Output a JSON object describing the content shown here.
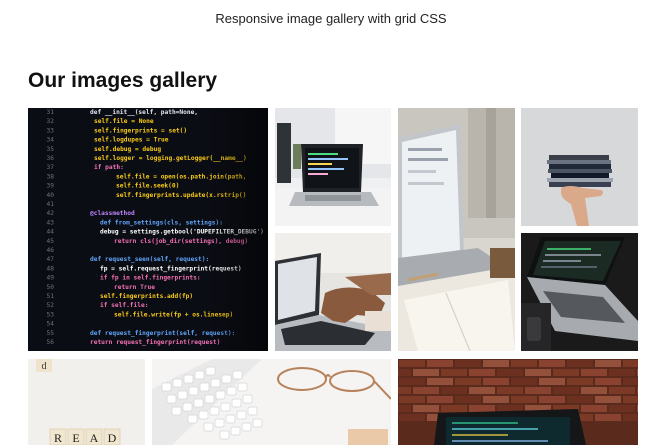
{
  "page": {
    "subtitle": "Responsive image gallery with grid CSS",
    "heading": "Our images gallery"
  },
  "gallery": {
    "photos": [
      {
        "name": "photo-code-closeup",
        "subject": "code editor closeup"
      },
      {
        "name": "photo-laptop-desk",
        "subject": "laptop on white desk"
      },
      {
        "name": "photo-laptop-notebook",
        "subject": "laptop and open notebook"
      },
      {
        "name": "photo-books-hand",
        "subject": "hand holding stack of books"
      },
      {
        "name": "photo-typing-laptop",
        "subject": "hands typing on laptop"
      },
      {
        "name": "photo-dark-laptop",
        "subject": "laptop on dark surface"
      },
      {
        "name": "photo-read-blocks",
        "subject": "letter blocks"
      },
      {
        "name": "photo-keyboard-glasses",
        "subject": "keyboard and glasses"
      },
      {
        "name": "photo-brick-laptop",
        "subject": "laptop in front of brick wall"
      }
    ],
    "read_word": "READ",
    "letter_block": "d"
  },
  "code_lines": [
    {
      "num": "31",
      "text": "def __init__(self, path=None,",
      "color": "#e2e8f0"
    },
    {
      "num": "32",
      "text": "self.file = None",
      "color": "#facc15"
    },
    {
      "num": "33",
      "text": "self.fingerprints = set()",
      "color": "#facc15"
    },
    {
      "num": "34",
      "text": "self.logdupes = True",
      "color": "#facc15"
    },
    {
      "num": "35",
      "text": "self.debug = debug",
      "color": "#facc15"
    },
    {
      "num": "36",
      "text": "self.logger = logging.getLogger(__name__)",
      "color": "#facc15"
    },
    {
      "num": "37",
      "text": "if path:",
      "color": "#f472b6"
    },
    {
      "num": "38",
      "text": "self.file = open(os.path.join(path,",
      "color": "#facc15"
    },
    {
      "num": "39",
      "text": "self.file.seek(0)",
      "color": "#facc15"
    },
    {
      "num": "40",
      "text": "self.fingerprints.update(x.rstrip()",
      "color": "#facc15"
    },
    {
      "num": "41",
      "text": "",
      "color": "#ffffff"
    },
    {
      "num": "42",
      "text": "@classmethod",
      "color": "#c084fc"
    },
    {
      "num": "43",
      "text": "def from_settings(cls, settings):",
      "color": "#60a5fa"
    },
    {
      "num": "44",
      "text": "debug = settings.getbool('DUPEFILTER_DEBUG')",
      "color": "#ffffff"
    },
    {
      "num": "45",
      "text": "return cls(job_dir(settings), debug)",
      "color": "#f472b6"
    },
    {
      "num": "46",
      "text": "",
      "color": "#ffffff"
    },
    {
      "num": "47",
      "text": "def request_seen(self, request):",
      "color": "#60a5fa"
    },
    {
      "num": "48",
      "text": "fp = self.request_fingerprint(request)",
      "color": "#ffffff"
    },
    {
      "num": "49",
      "text": "if fp in self.fingerprints:",
      "color": "#f472b6"
    },
    {
      "num": "50",
      "text": "return True",
      "color": "#f472b6"
    },
    {
      "num": "51",
      "text": "self.fingerprints.add(fp)",
      "color": "#facc15"
    },
    {
      "num": "52",
      "text": "if self.file:",
      "color": "#f472b6"
    },
    {
      "num": "53",
      "text": "self.file.write(fp + os.linesep)",
      "color": "#facc15"
    },
    {
      "num": "54",
      "text": "",
      "color": "#ffffff"
    },
    {
      "num": "55",
      "text": "def request_fingerprint(self, request):",
      "color": "#60a5fa"
    },
    {
      "num": "56",
      "text": "return request_fingerprint(request)",
      "color": "#f472b6"
    }
  ]
}
